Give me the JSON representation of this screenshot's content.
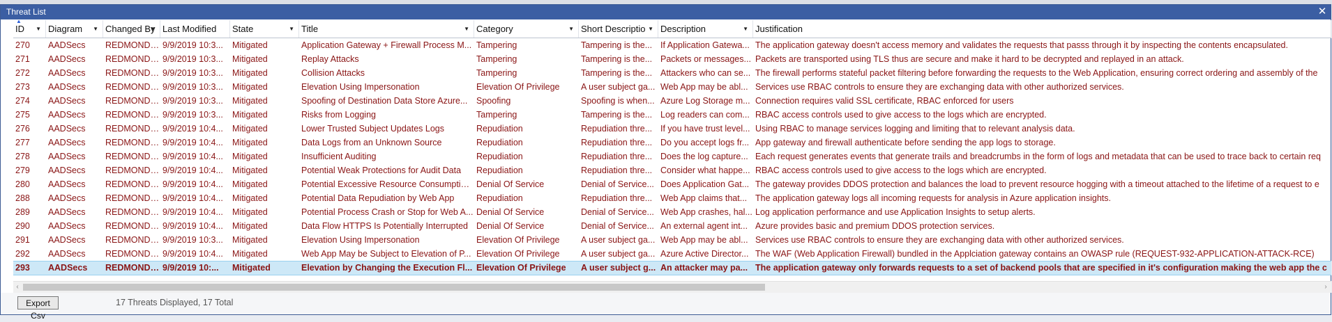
{
  "window": {
    "title": "Threat List",
    "close_glyph": "✕"
  },
  "grid": {
    "columns": [
      {
        "key": "id",
        "label": "ID",
        "filter": true
      },
      {
        "key": "diagram",
        "label": "Diagram",
        "filter": true
      },
      {
        "key": "changed_by",
        "label": "Changed By",
        "filter": true
      },
      {
        "key": "last_modified",
        "label": "Last Modified",
        "filter": false
      },
      {
        "key": "state",
        "label": "State",
        "filter": true
      },
      {
        "key": "title",
        "label": "Title",
        "filter": true
      },
      {
        "key": "category",
        "label": "Category",
        "filter": true
      },
      {
        "key": "short_description",
        "label": "Short Descriptio",
        "filter": true
      },
      {
        "key": "description",
        "label": "Description",
        "filter": true
      },
      {
        "key": "justification",
        "label": "Justification",
        "filter": false
      }
    ],
    "sort_column": "id",
    "filter_glyph": "▼",
    "sort_glyph": "▲",
    "rows": [
      {
        "id": "270",
        "diagram": "AADSecs",
        "changed_by": "REDMOND\\v-f...",
        "last_modified": "9/9/2019 10:3...",
        "state": "Mitigated",
        "title": "Application Gateway + Firewall Process M...",
        "category": "Tampering",
        "short_description": "Tampering is the...",
        "description": "If Application Gatewa...",
        "justification": "The application gateway doesn't access memory and validates the requests that passs through it by inspecting the contents encapsulated."
      },
      {
        "id": "271",
        "diagram": "AADSecs",
        "changed_by": "REDMOND\\v-f...",
        "last_modified": "9/9/2019 10:3...",
        "state": "Mitigated",
        "title": "Replay Attacks",
        "category": "Tampering",
        "short_description": "Tampering is the...",
        "description": "Packets or messages...",
        "justification": "Packets are transported using TLS thus are secure and make it hard to be decrypted and replayed in an attack."
      },
      {
        "id": "272",
        "diagram": "AADSecs",
        "changed_by": "REDMOND\\v-f...",
        "last_modified": "9/9/2019 10:3...",
        "state": "Mitigated",
        "title": "Collision Attacks",
        "category": "Tampering",
        "short_description": "Tampering is the...",
        "description": "Attackers who can se...",
        "justification": "The firewall performs stateful packet filtering before forwarding the requests to the Web Application, ensuring correct ordering and assembly of the"
      },
      {
        "id": "273",
        "diagram": "AADSecs",
        "changed_by": "REDMOND\\v-f...",
        "last_modified": "9/9/2019 10:3...",
        "state": "Mitigated",
        "title": "Elevation Using Impersonation",
        "category": "Elevation Of Privilege",
        "short_description": "A user subject ga...",
        "description": "Web App may be abl...",
        "justification": "Services use RBAC controls to ensure they are exchanging data with other authorized services."
      },
      {
        "id": "274",
        "diagram": "AADSecs",
        "changed_by": "REDMOND\\v-f...",
        "last_modified": "9/9/2019 10:3...",
        "state": "Mitigated",
        "title": "Spoofing of Destination Data Store Azure...",
        "category": "Spoofing",
        "short_description": "Spoofing is when...",
        "description": "Azure Log Storage m...",
        "justification": "Connection requires valid SSL certificate, RBAC enforced for users"
      },
      {
        "id": "275",
        "diagram": "AADSecs",
        "changed_by": "REDMOND\\v-f...",
        "last_modified": "9/9/2019 10:3...",
        "state": "Mitigated",
        "title": "Risks from Logging",
        "category": "Tampering",
        "short_description": "Tampering is the...",
        "description": "Log readers can com...",
        "justification": "RBAC access controls used to give access to the logs which are encrypted."
      },
      {
        "id": "276",
        "diagram": "AADSecs",
        "changed_by": "REDMOND\\v-f...",
        "last_modified": "9/9/2019 10:4...",
        "state": "Mitigated",
        "title": "Lower Trusted Subject Updates Logs",
        "category": "Repudiation",
        "short_description": "Repudiation thre...",
        "description": "If you have trust level...",
        "justification": "Using RBAC to manage services logging and limiting that to relevant analysis data."
      },
      {
        "id": "277",
        "diagram": "AADSecs",
        "changed_by": "REDMOND\\v-f...",
        "last_modified": "9/9/2019 10:4...",
        "state": "Mitigated",
        "title": "Data Logs from an Unknown Source",
        "category": "Repudiation",
        "short_description": "Repudiation thre...",
        "description": "Do you accept logs fr...",
        "justification": "App gateway and firewall authenticate before sending the app logs to storage."
      },
      {
        "id": "278",
        "diagram": "AADSecs",
        "changed_by": "REDMOND\\v-f...",
        "last_modified": "9/9/2019 10:4...",
        "state": "Mitigated",
        "title": "Insufficient Auditing",
        "category": "Repudiation",
        "short_description": "Repudiation thre...",
        "description": "Does the log capture...",
        "justification": "Each request generates events that generate trails and breadcrumbs in the form of logs and metadata that can be used to trace back to certain req"
      },
      {
        "id": "279",
        "diagram": "AADSecs",
        "changed_by": "REDMOND\\v-f...",
        "last_modified": "9/9/2019 10:4...",
        "state": "Mitigated",
        "title": "Potential Weak Protections for Audit Data",
        "category": "Repudiation",
        "short_description": "Repudiation thre...",
        "description": "Consider what happe...",
        "justification": "RBAC access controls used to give access to the logs which are encrypted."
      },
      {
        "id": "280",
        "diagram": "AADSecs",
        "changed_by": "REDMOND\\v-f...",
        "last_modified": "9/9/2019 10:4...",
        "state": "Mitigated",
        "title": "Potential Excessive Resource Consumption...",
        "category": "Denial Of Service",
        "short_description": "Denial of Service...",
        "description": "Does Application Gat...",
        "justification": "The gateway provides DDOS protection and balances the load to prevent resource hogging with a timeout attached to the lifetime of a request to e"
      },
      {
        "id": "288",
        "diagram": "AADSecs",
        "changed_by": "REDMOND\\v-f...",
        "last_modified": "9/9/2019 10:4...",
        "state": "Mitigated",
        "title": "Potential Data Repudiation by Web App",
        "category": "Repudiation",
        "short_description": "Repudiation thre...",
        "description": "Web App claims that...",
        "justification": "The application gateway logs all incoming requests for analysis in Azure application insights."
      },
      {
        "id": "289",
        "diagram": "AADSecs",
        "changed_by": "REDMOND\\v-f...",
        "last_modified": "9/9/2019 10:4...",
        "state": "Mitigated",
        "title": "Potential Process Crash or Stop for Web A...",
        "category": "Denial Of Service",
        "short_description": "Denial of Service...",
        "description": "Web App crashes, hal...",
        "justification": "Log application performance and use Application Insights to setup alerts."
      },
      {
        "id": "290",
        "diagram": "AADSecs",
        "changed_by": "REDMOND\\v-f...",
        "last_modified": "9/9/2019 10:4...",
        "state": "Mitigated",
        "title": "Data Flow HTTPS Is Potentially Interrupted",
        "category": "Denial Of Service",
        "short_description": "Denial of Service...",
        "description": "An external agent int...",
        "justification": "Azure provides basic and premium DDOS protection services."
      },
      {
        "id": "291",
        "diagram": "AADSecs",
        "changed_by": "REDMOND\\v-f...",
        "last_modified": "9/9/2019 10:3...",
        "state": "Mitigated",
        "title": "Elevation Using Impersonation",
        "category": "Elevation Of Privilege",
        "short_description": "A user subject ga...",
        "description": "Web App may be abl...",
        "justification": "Services use RBAC controls to ensure they are exchanging data with other authorized services."
      },
      {
        "id": "292",
        "diagram": "AADSecs",
        "changed_by": "REDMOND\\v-f...",
        "last_modified": "9/9/2019 10:4...",
        "state": "Mitigated",
        "title": "Web App May be Subject to Elevation of P...",
        "category": "Elevation Of Privilege",
        "short_description": "A user subject ga...",
        "description": "Azure Active Director...",
        "justification": "The WAF (Web Application Firewall) bundled in the Applciation gateway contains an OWASP rule (REQUEST-932-APPLICATION-ATTACK-RCE)"
      },
      {
        "id": "293",
        "diagram": "AADSecs",
        "changed_by": "REDMOND\\v...",
        "last_modified": "9/9/2019 10:...",
        "state": "Mitigated",
        "title": "Elevation by Changing the Execution Fl...",
        "category": "Elevation Of Privilege",
        "short_description": "A user subject g...",
        "description": "An attacker may pa...",
        "justification": "The application gateway only forwards requests to a set of backend pools that are specified in it's configuration making the web app the c",
        "selected": true
      }
    ]
  },
  "scrollbar": {
    "left_glyph": "‹",
    "right_glyph": "›"
  },
  "footer": {
    "export_label": "Export Csv",
    "status_text": "17 Threats Displayed, 17 Total"
  },
  "colors": {
    "titlebar": "#3b5ea3",
    "row_text": "#8a1515",
    "selected_row": "#cde8f7",
    "sort_indicator": "#2b5fd9"
  }
}
